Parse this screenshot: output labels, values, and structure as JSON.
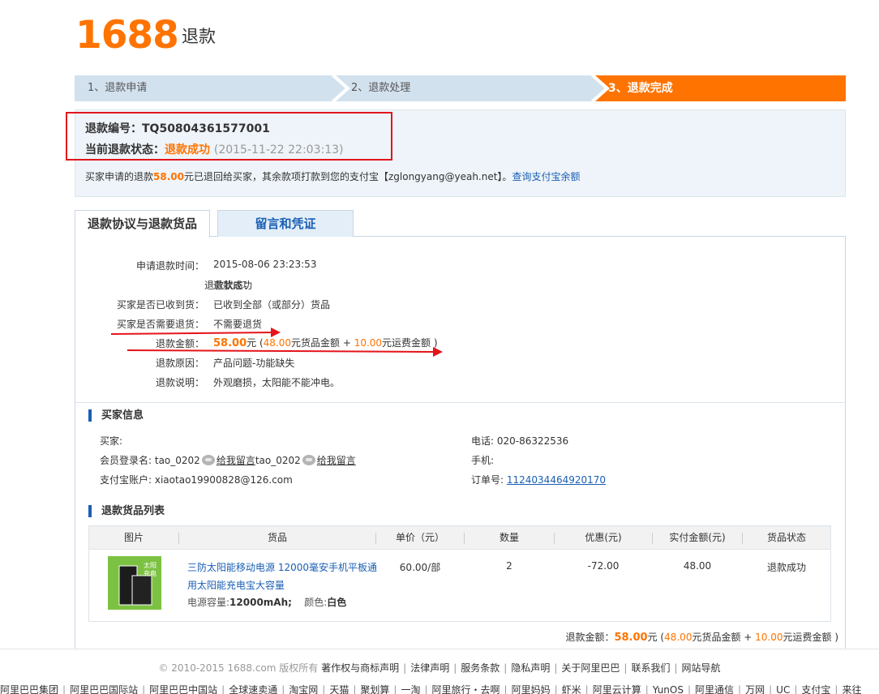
{
  "header": {
    "logo": "1688",
    "title": "退款"
  },
  "steps": [
    {
      "label": "1、退款申请"
    },
    {
      "label": "2、退款处理"
    },
    {
      "label": "3、退款完成"
    }
  ],
  "summary": {
    "refund_no_label": "退款编号：",
    "refund_no": "TQ50804361577001",
    "status_label": "当前退款状态：",
    "status": "退款成功",
    "status_time": "(2015-11-22 22:03:13)",
    "notice_prefix": "买家申请的退款",
    "notice_amount": "58.00",
    "notice_suffix": "元已退回给买家，其余款项打款到您的支付宝【zglongyang@yeah.net】。",
    "notice_link": "查询支付宝余额"
  },
  "tabs": [
    {
      "label": "退款协议与退款货品"
    },
    {
      "label": "留言和凭证"
    }
  ],
  "agreement": {
    "rows": [
      {
        "label": "申请退款时间：",
        "value": "2015-08-06 23:23:53"
      },
      {
        "label": "退款状态：",
        "value": "退款成功"
      },
      {
        "label": "买家是否已收到货：",
        "value": "已收到全部（或部分）货品"
      },
      {
        "label": "买家是否需要退货：",
        "value": "不需要退货"
      },
      {
        "label": "退款金额：",
        "value": ""
      },
      {
        "label": "退款原因：",
        "value": "产品问题-功能缺失"
      },
      {
        "label": "退款说明：",
        "value": "外观磨损，太阳能不能冲电。"
      }
    ],
    "amount": {
      "total": "58.00",
      "unit": "元",
      "open": " (",
      "goods": "48.00",
      "goods_text": "元货品金额 + ",
      "shipping": "10.00",
      "shipping_text": "元运费金额 )"
    }
  },
  "buyer": {
    "section_title": "买家信息",
    "buyer_label": "买家:",
    "member_label": "会员登录名:",
    "member_name": "tao_0202",
    "msg_link": "给我留言",
    "alipay_label": "支付宝账户:",
    "alipay": "xiaotao19900828@126.com",
    "phone_label": "电话:",
    "phone": "020-86322536",
    "mobile_label": "手机:",
    "order_label": "订单号:",
    "order_no": "1124034464920170"
  },
  "goods": {
    "section_title": "退款货品列表",
    "columns": [
      "图片",
      "货品",
      "单价（元）",
      "数量",
      "优惠(元)",
      "实付金额(元)",
      "货品状态"
    ],
    "items": [
      {
        "image_text": "太阳\n充电",
        "name": "三防太阳能移动电源 12000毫安手机平板通用太阳能充电宝大容量",
        "capacity_label": "电源容量:",
        "capacity": "12000mAh;",
        "color_label": "颜色:",
        "color": "白色",
        "price": "60.00/部",
        "qty": "2",
        "discount": "-72.00",
        "paid": "48.00",
        "status": "退款成功"
      }
    ],
    "summary_label": "退款金额：",
    "summary_total": "58.00",
    "summary_unit": "元 (",
    "summary_goods": "48.00",
    "summary_goods_text": "元货品金额 + ",
    "summary_shipping": "10.00",
    "summary_shipping_text": "元运费金额 )"
  },
  "footer": {
    "copyright": "© 2010-2015 1688.com 版权所有",
    "links": [
      "著作权与商标声明",
      "法律声明",
      "服务条款",
      "隐私声明",
      "关于阿里巴巴",
      "联系我们",
      "网站导航"
    ],
    "group_links": [
      "阿里巴巴集团",
      "阿里巴巴国际站",
      "阿里巴巴中国站",
      "全球速卖通",
      "淘宝网",
      "天猫",
      "聚划算",
      "一淘",
      "阿里旅行・去啊",
      "阿里妈妈",
      "虾米",
      "阿里云计算",
      "YunOS",
      "阿里通信",
      "万网",
      "UC",
      "支付宝",
      "来往"
    ]
  },
  "colors": {
    "brand": "#ff7300",
    "step_inactive": "#d2e1ee",
    "step_active": "#ff7300",
    "link": "#1a5fb4",
    "annotation": "#e4141b"
  }
}
